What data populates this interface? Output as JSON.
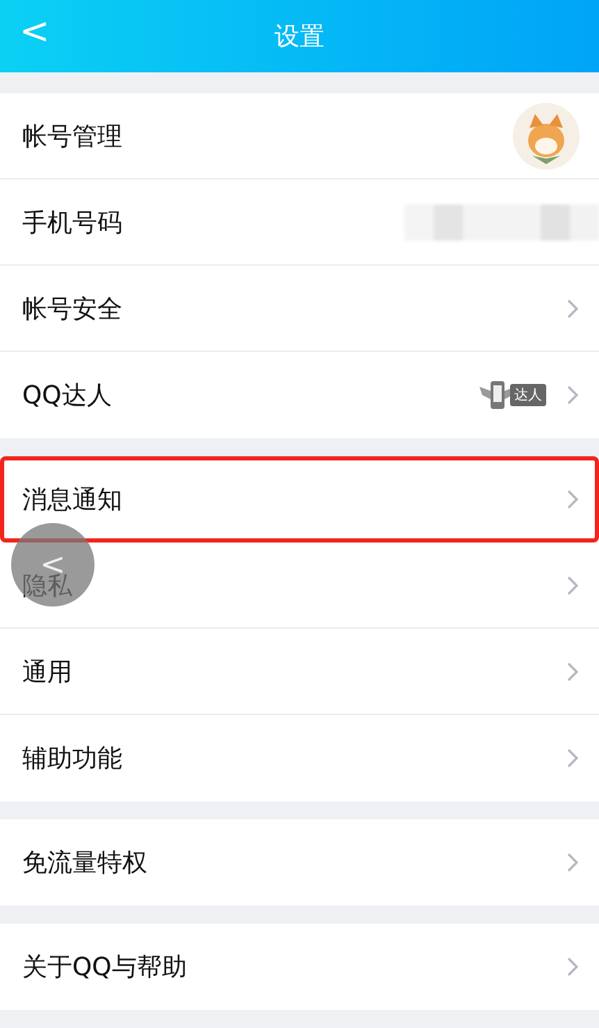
{
  "header": {
    "back": "<",
    "title": "设置"
  },
  "groups": [
    {
      "rows": [
        {
          "label": "帐号管理",
          "kind": "avatar",
          "highlighted": false
        },
        {
          "label": "手机号码",
          "kind": "blurred",
          "highlighted": false
        },
        {
          "label": "帐号安全",
          "kind": "chevron",
          "highlighted": false
        },
        {
          "label": "QQ达人",
          "kind": "badge",
          "badge": "达人",
          "highlighted": false
        }
      ]
    },
    {
      "rows": [
        {
          "label": "消息通知",
          "kind": "chevron",
          "highlighted": true
        },
        {
          "label": "隐私",
          "kind": "chevron",
          "highlighted": false
        },
        {
          "label": "通用",
          "kind": "chevron",
          "highlighted": false
        },
        {
          "label": "辅助功能",
          "kind": "chevron",
          "highlighted": false
        }
      ]
    },
    {
      "rows": [
        {
          "label": "免流量特权",
          "kind": "chevron",
          "highlighted": false
        }
      ]
    },
    {
      "rows": [
        {
          "label": "关于QQ与帮助",
          "kind": "chevron",
          "highlighted": false
        }
      ]
    }
  ],
  "floating_button": {
    "icon": "<"
  }
}
